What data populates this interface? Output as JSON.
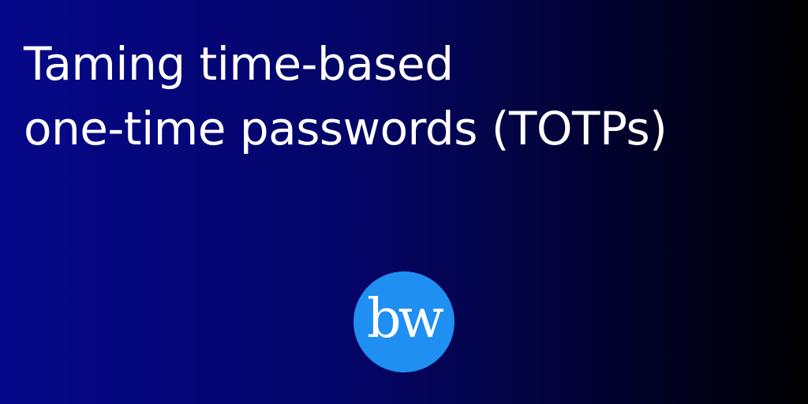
{
  "title": {
    "line1": "Taming time-based",
    "line2": "one-time passwords (TOTPs)"
  },
  "logo": {
    "text": "bw",
    "color": "#1f8ff2"
  },
  "background": {
    "gradient_start": "#06088a",
    "gradient_end": "#000000"
  }
}
